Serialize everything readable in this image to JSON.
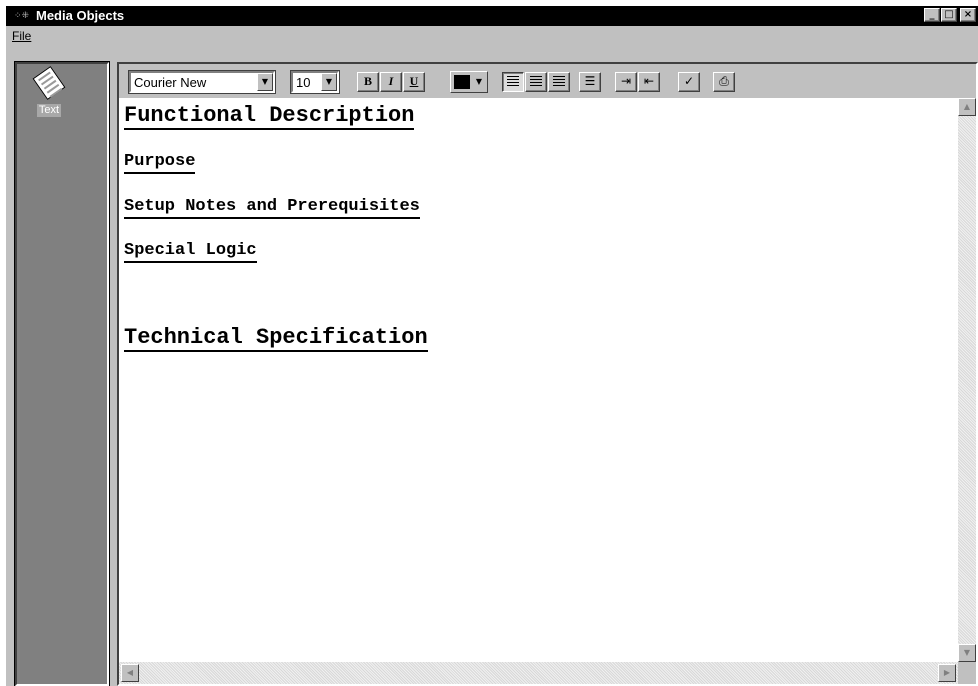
{
  "window": {
    "title": "Media Objects",
    "controls": {
      "minimize": "_",
      "maximize": "□",
      "close": "×"
    }
  },
  "menu": {
    "file": "File"
  },
  "sidebar": {
    "shortcut_label": "Text",
    "shortcut_icon": "document-icon"
  },
  "toolbar": {
    "font_name": "Courier New",
    "font_size": "10",
    "bold": "B",
    "italic": "I",
    "underline": "U",
    "text_color": "#000000",
    "icons": [
      "align-left-icon",
      "align-center-icon",
      "align-right-icon",
      "bullet-list-icon",
      "indent-icon",
      "outdent-icon",
      "spellcheck-icon",
      "print-icon"
    ]
  },
  "document": {
    "lines": [
      "Functional Description",
      "Purpose",
      "Setup Notes and Prerequisites",
      "Special Logic",
      "Technical Specification"
    ]
  }
}
